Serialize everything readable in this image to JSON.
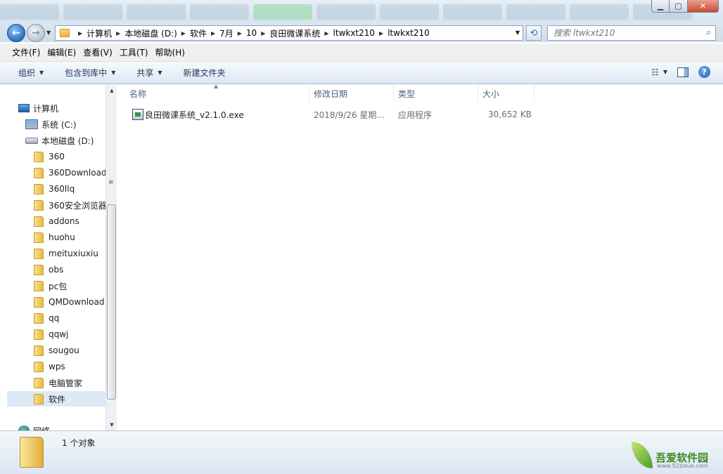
{
  "window": {
    "controls": {
      "minimize": "▁",
      "maximize": "▢",
      "close": "✕"
    }
  },
  "address": {
    "back_icon": "back-arrow-icon",
    "forward_icon": "forward-arrow-icon",
    "breadcrumb": [
      "计算机",
      "本地磁盘 (D:)",
      "软件",
      "7月",
      "10",
      "良田微课系统",
      "ltwkxt210",
      "ltwkxt210"
    ],
    "refresh_icon": "refresh-icon"
  },
  "search": {
    "placeholder": "搜索 ltwkxt210"
  },
  "menu": [
    "文件(F)",
    "编辑(E)",
    "查看(V)",
    "工具(T)",
    "帮助(H)"
  ],
  "toolbar": {
    "organize": "组织",
    "include_in_library": "包含到库中",
    "share": "共享",
    "new_folder": "新建文件夹"
  },
  "nav": {
    "computer": "计算机",
    "drive_c": "系统 (C:)",
    "drive_d": "本地磁盘 (D:)",
    "folders": [
      "360",
      "360Download",
      "360llq",
      "360安全浏览器",
      "addons",
      "huohu",
      "meituxiuxiu",
      "obs",
      "pc包",
      "QMDownload",
      "qq",
      "qqwj",
      "sougou",
      "wps",
      "电脑管家",
      "软件"
    ],
    "selected_folder": "软件",
    "network": "网络"
  },
  "columns": {
    "name": "名称",
    "modified": "修改日期",
    "type": "类型",
    "size": "大小"
  },
  "files": [
    {
      "name": "良田微课系统_v2.1.0.exe",
      "modified": "2018/9/26 星期...",
      "type": "应用程序",
      "size": "30,652 KB"
    }
  ],
  "status": {
    "count": "1 个对象"
  },
  "watermark": {
    "logo_text": "吾爱软件园",
    "url": "www.52zixue.com"
  },
  "colors": {
    "accent": "#1f5cae",
    "selection": "#dde9f7",
    "header_text": "#4c607a"
  }
}
